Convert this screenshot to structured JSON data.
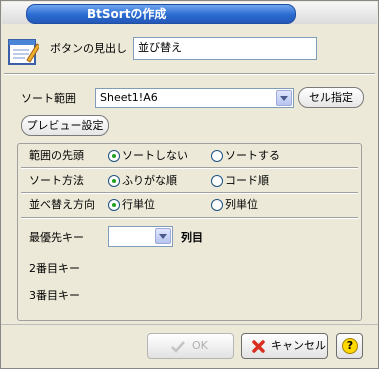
{
  "window": {
    "title": "BtSortの作成"
  },
  "header": {
    "caption_label": "ボタンの見出し",
    "caption_value": "並び替え"
  },
  "range": {
    "label": "ソート範囲",
    "value": "Sheet1!A6",
    "select_button": "セル指定"
  },
  "preview_button": "プレビュー設定",
  "options": {
    "head_row": {
      "label": "範囲の先頭",
      "opt1": "ソートしない",
      "opt2": "ソートする",
      "selected": 1
    },
    "method": {
      "label": "ソート方法",
      "opt1": "ふりがな順",
      "opt2": "コード順",
      "selected": 1
    },
    "direction": {
      "label": "並べ替え方向",
      "opt1": "行単位",
      "opt2": "列単位",
      "selected": 1
    }
  },
  "keys": {
    "key1_label": "最優先キー",
    "key1_unit": "列目",
    "key2_label": "2番目キー",
    "key3_label": "3番目キー"
  },
  "buttons": {
    "ok": "OK",
    "cancel": "キャンセル",
    "help": "?"
  },
  "colors": {
    "title_blue": "#2a6bd0",
    "radio_dot": "#21a121",
    "cancel_x": "#d83020",
    "help_yellow": "#ffd800"
  }
}
